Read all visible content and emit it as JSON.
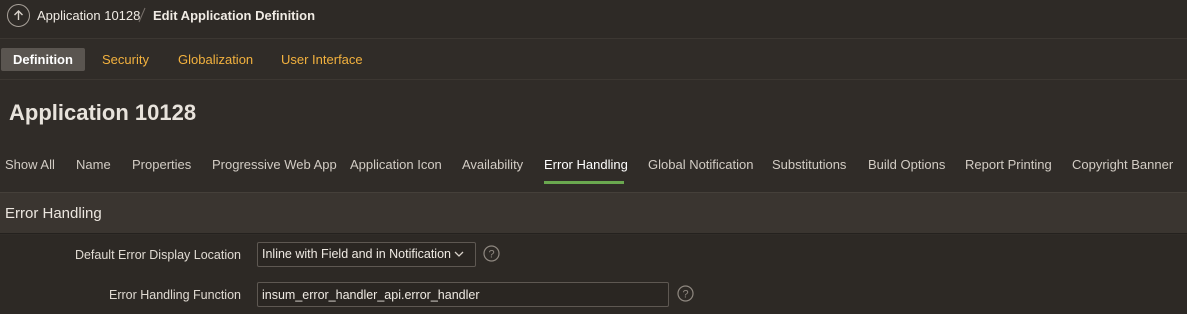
{
  "breadcrumb": {
    "app": "Application 10128",
    "page": "Edit Application Definition"
  },
  "top_tabs": [
    {
      "label": "Definition",
      "active": true
    },
    {
      "label": "Security",
      "active": false
    },
    {
      "label": "Globalization",
      "active": false
    },
    {
      "label": "User Interface",
      "active": false
    }
  ],
  "app_title": "Application 10128",
  "section_tabs": [
    {
      "label": "Show All"
    },
    {
      "label": "Name"
    },
    {
      "label": "Properties"
    },
    {
      "label": "Progressive Web App"
    },
    {
      "label": "Application Icon"
    },
    {
      "label": "Availability"
    },
    {
      "label": "Error Handling",
      "active": true
    },
    {
      "label": "Global Notification"
    },
    {
      "label": "Substitutions"
    },
    {
      "label": "Build Options"
    },
    {
      "label": "Report Printing"
    },
    {
      "label": "Copyright Banner"
    }
  ],
  "region": {
    "title": "Error Handling",
    "fields": {
      "display_location": {
        "label": "Default Error Display Location",
        "value": "Inline with Field and in Notification"
      },
      "handling_function": {
        "label": "Error Handling Function",
        "value": "insum_error_handler_api.error_handler"
      }
    }
  },
  "colors": {
    "accent_tab": "#f2b13e",
    "active_underline": "#6aa84f",
    "background": "#302c28"
  },
  "icons": {
    "up": "arrow-up-circle-icon",
    "help": "help-circle-icon",
    "chevron": "chevron-down-icon"
  }
}
